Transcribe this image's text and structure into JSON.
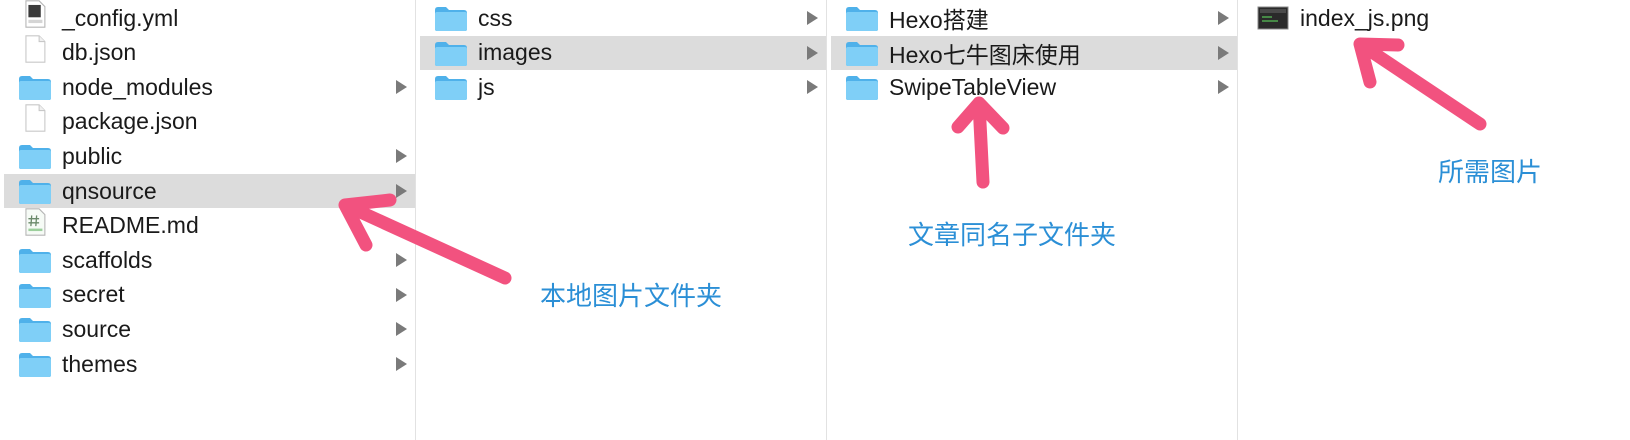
{
  "columns": [
    {
      "items": [
        {
          "name": "_config.yml",
          "icon": "yaml-file-icon",
          "selected": false,
          "chevron": false
        },
        {
          "name": "db.json",
          "icon": "blank-file-icon",
          "selected": false,
          "chevron": false
        },
        {
          "name": "node_modules",
          "icon": "folder-icon",
          "selected": false,
          "chevron": true
        },
        {
          "name": "package.json",
          "icon": "blank-file-icon",
          "selected": false,
          "chevron": false
        },
        {
          "name": "public",
          "icon": "folder-icon",
          "selected": false,
          "chevron": true
        },
        {
          "name": "qnsource",
          "icon": "folder-icon",
          "selected": true,
          "chevron": true
        },
        {
          "name": "README.md",
          "icon": "markdown-file-icon",
          "selected": false,
          "chevron": false
        },
        {
          "name": "scaffolds",
          "icon": "folder-icon",
          "selected": false,
          "chevron": true
        },
        {
          "name": "secret",
          "icon": "folder-icon",
          "selected": false,
          "chevron": true
        },
        {
          "name": "source",
          "icon": "folder-icon",
          "selected": false,
          "chevron": true
        },
        {
          "name": "themes",
          "icon": "folder-icon",
          "selected": false,
          "chevron": true
        }
      ]
    },
    {
      "items": [
        {
          "name": "css",
          "icon": "folder-icon",
          "selected": false,
          "chevron": true
        },
        {
          "name": "images",
          "icon": "folder-icon",
          "selected": true,
          "chevron": true
        },
        {
          "name": "js",
          "icon": "folder-icon",
          "selected": false,
          "chevron": true
        }
      ]
    },
    {
      "items": [
        {
          "name": "Hexo搭建",
          "icon": "folder-icon",
          "selected": false,
          "chevron": true
        },
        {
          "name": "Hexo七牛图床使用",
          "icon": "folder-icon",
          "selected": true,
          "chevron": true
        },
        {
          "name": "SwipeTableView",
          "icon": "folder-icon",
          "selected": false,
          "chevron": true
        }
      ]
    },
    {
      "items": [
        {
          "name": "index_js.png",
          "icon": "image-file-icon",
          "selected": false,
          "chevron": false
        }
      ]
    }
  ],
  "annotations": {
    "local_image_folder": "本地图片文件夹",
    "same_name_subfolder": "文章同名子文件夹",
    "required_image": "所需图片"
  },
  "colors": {
    "selection": "#dcdcdc",
    "folder": "#6cc4f4",
    "arrow": "#f2527f",
    "annotation_text": "#2b8fd6",
    "chevron": "#7a7a7a"
  }
}
